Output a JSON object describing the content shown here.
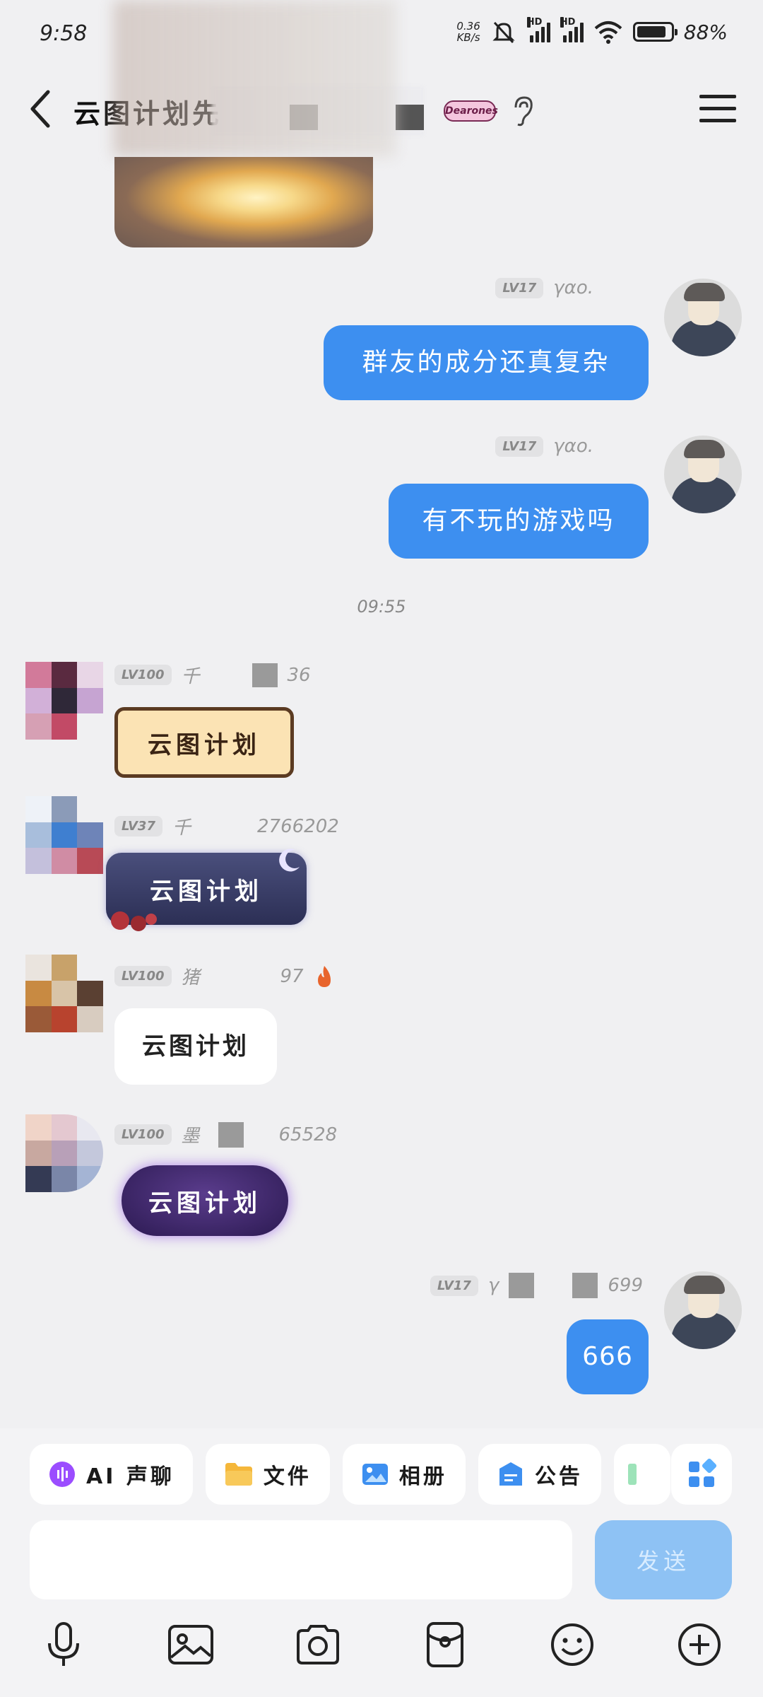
{
  "status_bar": {
    "time": "9:58",
    "net_speed_value": "0.36",
    "net_speed_unit": "KB/s",
    "signal1_label": "HD",
    "signal2_label": "HD",
    "battery_percent": "88%",
    "battery_level": 0.88
  },
  "header": {
    "title": "云图计划先",
    "badge_label": "Dearones"
  },
  "messages": [
    {
      "side": "right",
      "level": "LV17",
      "sender": "γαο.",
      "text": "群友的成分还真复杂"
    },
    {
      "side": "right",
      "level": "LV17",
      "sender": "γαο.",
      "text": "有不玩的游戏吗"
    },
    {
      "type": "time",
      "text": "09:55"
    },
    {
      "side": "left",
      "level": "LV100",
      "sender": "千",
      "sender_suffix": "36",
      "text": "云图计划",
      "style": "scroll"
    },
    {
      "side": "left",
      "level": "LV37",
      "sender": "千",
      "sender_suffix": "2766202",
      "text": "云图计划",
      "style": "night"
    },
    {
      "side": "left",
      "level": "LV100",
      "sender": "猪",
      "sender_suffix": "97",
      "text": "云图计划",
      "style": "white"
    },
    {
      "side": "left",
      "level": "LV100",
      "sender": "墨",
      "sender_suffix": "65528",
      "text": "云图计划",
      "style": "purple"
    },
    {
      "side": "right",
      "level": "LV17",
      "sender": "γ",
      "sender_suffix": "699",
      "text": "666"
    }
  ],
  "quick_actions": [
    {
      "label": "AI 声聊",
      "icon": "ai-voice-icon",
      "color": "#9b4dff"
    },
    {
      "label": "文件",
      "icon": "folder-icon",
      "color": "#f5b73a"
    },
    {
      "label": "相册",
      "icon": "album-icon",
      "color": "#3d8ff0"
    },
    {
      "label": "公告",
      "icon": "announcement-icon",
      "color": "#3d8ff0"
    }
  ],
  "composer": {
    "send_label": "发送"
  },
  "toolbar": [
    "microphone-icon",
    "image-icon",
    "camera-icon",
    "red-packet-icon",
    "emoji-icon",
    "plus-icon"
  ],
  "colors": {
    "accent_blue": "#3d8ff0",
    "background": "#f0f0f2"
  }
}
